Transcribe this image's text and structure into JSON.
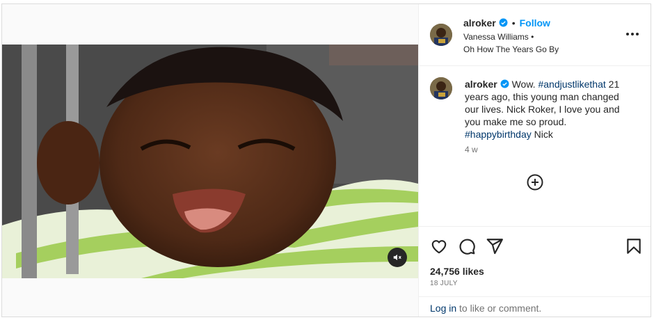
{
  "post": {
    "username": "alroker",
    "follow_label": "Follow",
    "separator": "•",
    "audio_artist": "Vanessa Williams",
    "audio_dot": "•",
    "audio_title": "Oh How The Years Go By",
    "caption_user": "alroker",
    "caption_part1": "Wow.",
    "hashtag1": "#andjustlikethat",
    "caption_part2": "21 years ago, this young man changed our lives. Nick Roker, I love you and you make me so proud.",
    "hashtag2": "#happybirthday",
    "caption_part3": "Nick",
    "time_ago": "4 w",
    "likes": "24,756 likes",
    "date": "18 JULY",
    "login_link": "Log in",
    "login_rest": "to like or comment."
  },
  "icons": {
    "verified": "verified-badge-icon",
    "more": "more-options-icon",
    "add_comment": "plus-circle-icon",
    "like": "heart-icon",
    "comment": "comment-icon",
    "share": "share-icon",
    "save": "bookmark-icon",
    "mute": "muted-speaker-icon"
  },
  "colors": {
    "accent": "#0095f6",
    "verified": "#0095f6",
    "link": "#00376b"
  }
}
